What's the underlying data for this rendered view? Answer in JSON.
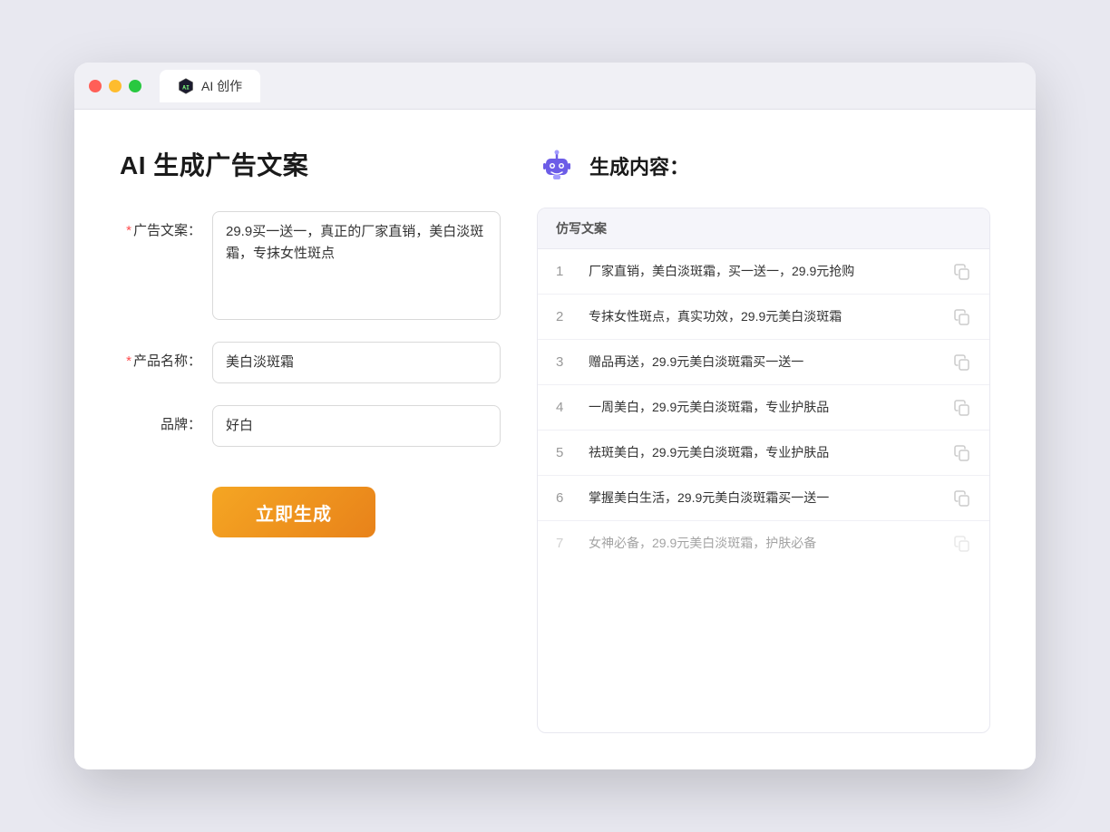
{
  "window": {
    "tab_label": "AI 创作"
  },
  "left": {
    "title": "AI 生成广告文案",
    "form": {
      "ad_copy_label": "广告文案：",
      "ad_copy_required": "*",
      "ad_copy_value": "29.9买一送一，真正的厂家直销，美白淡斑霜，专抹女性斑点",
      "product_label": "产品名称：",
      "product_required": "*",
      "product_value": "美白淡斑霜",
      "brand_label": "品牌：",
      "brand_value": "好白"
    },
    "generate_btn": "立即生成"
  },
  "right": {
    "title": "生成内容：",
    "table_header": "仿写文案",
    "results": [
      {
        "num": "1",
        "text": "厂家直销，美白淡斑霜，买一送一，29.9元抢购",
        "faded": false
      },
      {
        "num": "2",
        "text": "专抹女性斑点，真实功效，29.9元美白淡斑霜",
        "faded": false
      },
      {
        "num": "3",
        "text": "赠品再送，29.9元美白淡斑霜买一送一",
        "faded": false
      },
      {
        "num": "4",
        "text": "一周美白，29.9元美白淡斑霜，专业护肤品",
        "faded": false
      },
      {
        "num": "5",
        "text": "祛斑美白，29.9元美白淡斑霜，专业护肤品",
        "faded": false
      },
      {
        "num": "6",
        "text": "掌握美白生活，29.9元美白淡斑霜买一送一",
        "faded": false
      },
      {
        "num": "7",
        "text": "女神必备，29.9元美白淡斑霜，护肤必备",
        "faded": true
      }
    ]
  }
}
